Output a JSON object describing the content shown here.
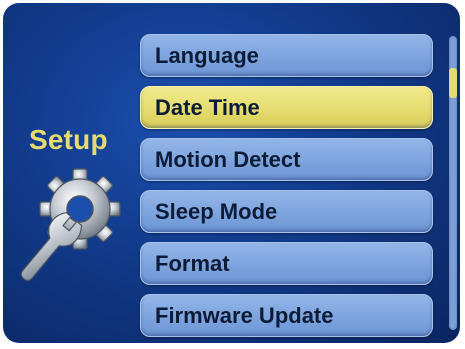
{
  "sidebar": {
    "title": "Setup",
    "icon": "gear-wrench-icon"
  },
  "menu": {
    "items": [
      {
        "label": "Language",
        "selected": false
      },
      {
        "label": "Date Time",
        "selected": true
      },
      {
        "label": "Motion Detect",
        "selected": false
      },
      {
        "label": "Sleep Mode",
        "selected": false
      },
      {
        "label": "Format",
        "selected": false
      },
      {
        "label": "Firmware Update",
        "selected": false
      }
    ]
  },
  "colors": {
    "background": "#113a8a",
    "item": "#7ea4de",
    "selected": "#e6dc70",
    "title": "#e6dc6e",
    "text": "#0c1c36"
  },
  "scroll": {
    "position": 0.12
  }
}
